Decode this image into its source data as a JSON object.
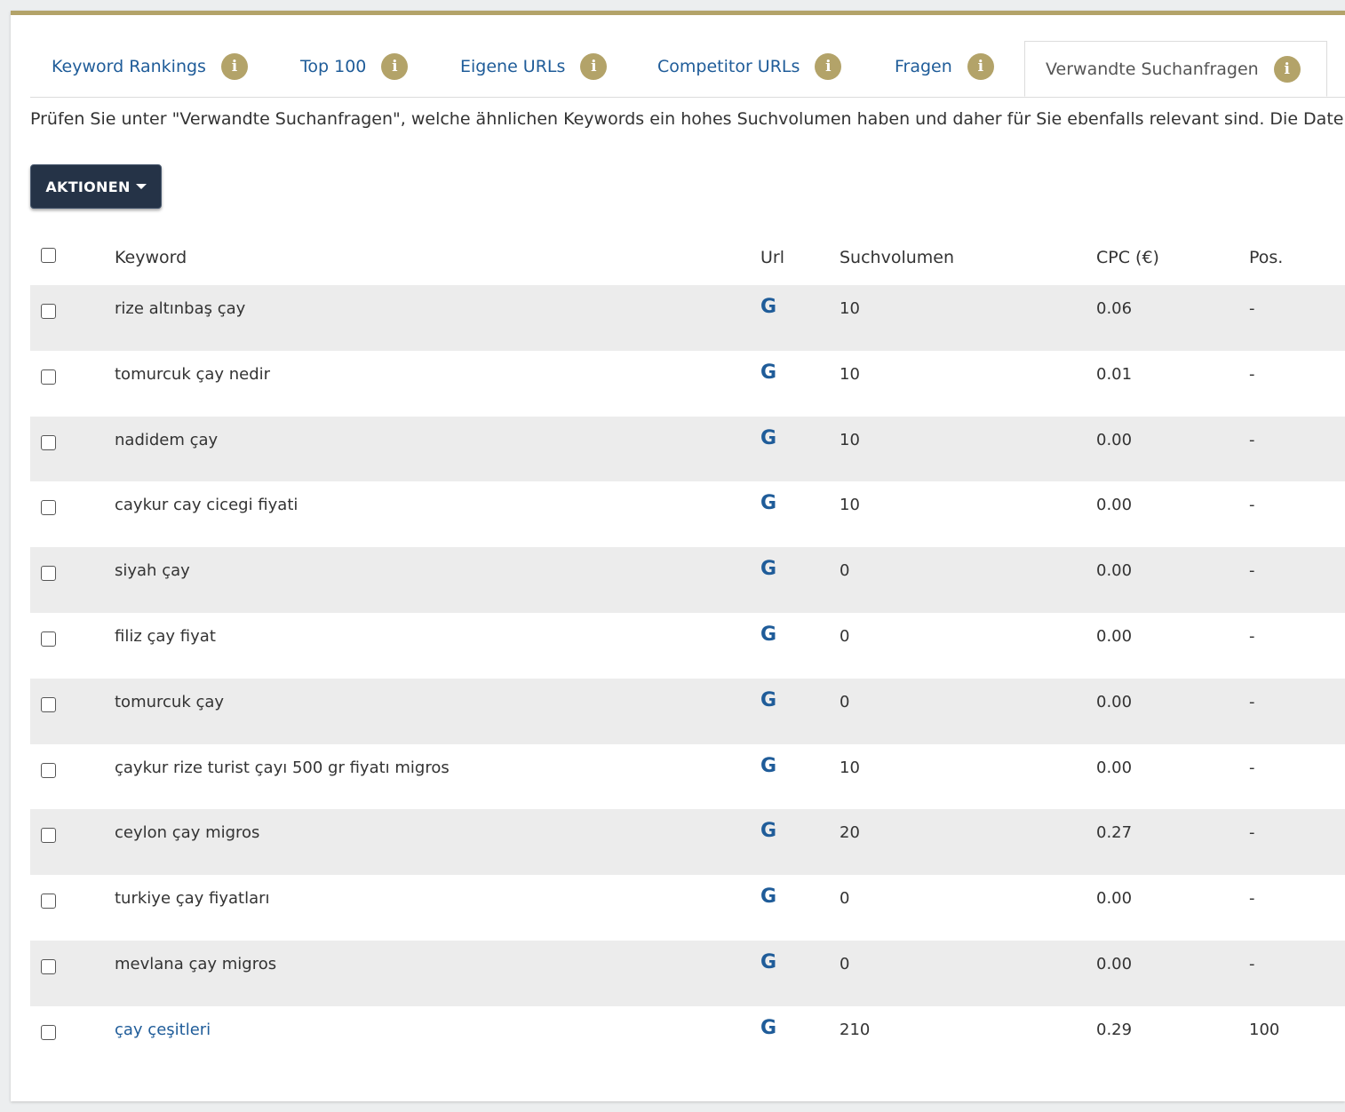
{
  "tabs": [
    {
      "label": "Keyword Rankings",
      "info_icon": "i",
      "active": false
    },
    {
      "label": "Top 100",
      "info_icon": "i",
      "active": false
    },
    {
      "label": "Eigene URLs",
      "info_icon": "i",
      "active": false
    },
    {
      "label": "Competitor URLs",
      "info_icon": "i",
      "active": false
    },
    {
      "label": "Fragen",
      "info_icon": "i",
      "active": false
    },
    {
      "label": "Verwandte Suchanfragen",
      "info_icon": "i",
      "active": true
    }
  ],
  "description": "Prüfen Sie unter \"Verwandte Suchanfragen\", welche ähnlichen Keywords ein hohes Suchvolumen haben und daher für Sie ebenfalls relevant sind. Die Daten",
  "actions_button": "AKTIONEN",
  "table": {
    "headers": {
      "keyword": "Keyword",
      "url": "Url",
      "volume": "Suchvolumen",
      "cpc": "CPC (€)",
      "pos": "Pos."
    },
    "url_icon_glyph": "G",
    "rows": [
      {
        "keyword": "rize altınbaş çay",
        "volume": "10",
        "cpc": "0.06",
        "pos": "-"
      },
      {
        "keyword": "tomurcuk çay nedir",
        "volume": "10",
        "cpc": "0.01",
        "pos": "-"
      },
      {
        "keyword": "nadidem çay",
        "volume": "10",
        "cpc": "0.00",
        "pos": "-"
      },
      {
        "keyword": "caykur cay cicegi fiyati",
        "volume": "10",
        "cpc": "0.00",
        "pos": "-"
      },
      {
        "keyword": "siyah çay",
        "volume": "0",
        "cpc": "0.00",
        "pos": "-"
      },
      {
        "keyword": "filiz çay fiyat",
        "volume": "0",
        "cpc": "0.00",
        "pos": "-"
      },
      {
        "keyword": "tomurcuk çay",
        "volume": "0",
        "cpc": "0.00",
        "pos": "-"
      },
      {
        "keyword": "çaykur rize turist çayı 500 gr fiyatı migros",
        "volume": "10",
        "cpc": "0.00",
        "pos": "-"
      },
      {
        "keyword": "ceylon çay migros",
        "volume": "20",
        "cpc": "0.27",
        "pos": "-"
      },
      {
        "keyword": "turkiye çay fiyatları",
        "volume": "0",
        "cpc": "0.00",
        "pos": "-"
      },
      {
        "keyword": "mevlana çay migros",
        "volume": "0",
        "cpc": "0.00",
        "pos": "-"
      },
      {
        "keyword": "çay çeşitleri",
        "volume": "210",
        "cpc": "0.29",
        "pos": "100",
        "is_link": true
      }
    ]
  },
  "colors": {
    "accent_gold": "#b3a369",
    "link_blue": "#1f5c99",
    "button_navy": "#253347",
    "stripe": "#ececec"
  }
}
